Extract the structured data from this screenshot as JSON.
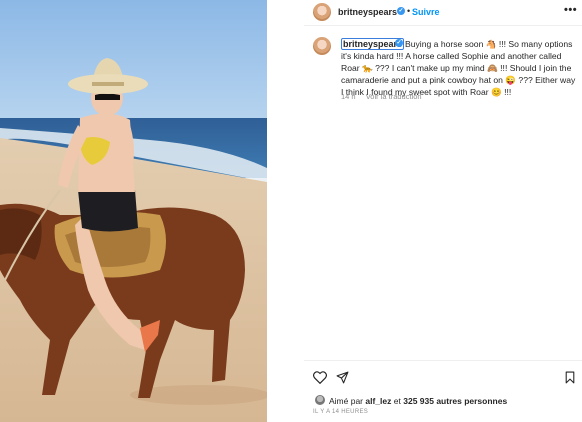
{
  "post": {
    "author": "britneyspears",
    "follow_label": "Suivre",
    "more_label": "•••",
    "dot": "•"
  },
  "caption": {
    "author": "britneyspears",
    "text": "Buying a horse soon 🐴 !!! So many options it's kinda hard !!! A horse called Sophie and another called Roar 🐆 ??? I can't make up my mind 🙈 !!! Should I join the camaraderie and put a pink cowboy hat on 😜 ??? Either way I think I found my sweet spot with Roar 😊 !!!",
    "age": "14 h",
    "translate_label": "Voir la traduction"
  },
  "likes": {
    "prefix": "Aimé par",
    "user": "alf_lez",
    "connector": "et",
    "count": "325 935 autres personnes"
  },
  "timestamp": "IL Y A 14 HEURES",
  "colors": {
    "accent": "#0095f6",
    "verified": "#3897f0",
    "text": "#262626",
    "muted": "#8e8e8e"
  }
}
